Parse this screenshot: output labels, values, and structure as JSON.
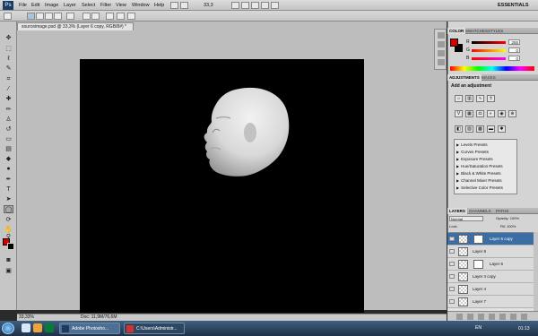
{
  "menubar": {
    "logo": "Ps",
    "items": [
      "File",
      "Edit",
      "Image",
      "Layer",
      "Select",
      "Filter",
      "View",
      "Window",
      "Help"
    ],
    "zoom": "33,3",
    "workspace": "ESSENTIALS"
  },
  "document": {
    "tab_title": "sourceimage.psd @ 33,3% (Layer 6 copy, RGB/8#) *",
    "zoom": "33,33%",
    "doc_info": "Doc: 11,9M/76,6M"
  },
  "color_panel": {
    "tabs": [
      "COLOR",
      "SWATCHES",
      "STYLES"
    ],
    "channels": [
      {
        "label": "R",
        "value": "255"
      },
      {
        "label": "G",
        "value": "0"
      },
      {
        "label": "B",
        "value": "0"
      }
    ],
    "fg_color": "#d40000",
    "bg_color": "#000000"
  },
  "adjustments": {
    "tabs": [
      "ADJUSTMENTS",
      "MASKS"
    ],
    "title": "Add an adjustment",
    "presets": [
      "Levels Presets",
      "Curves Presets",
      "Exposure Presets",
      "Hue/Saturation Presets",
      "Black & White Presets",
      "Channel Mixer Presets",
      "Selective Color Presets"
    ]
  },
  "layers_panel": {
    "tabs": [
      "LAYERS",
      "CHANNELS",
      "PATHS"
    ],
    "blend_mode": "Normal",
    "opacity_label": "Opacity:",
    "opacity_value": "100%",
    "lock_label": "Lock:",
    "fill_label": "Fill:",
    "fill_value": "100%",
    "layers": [
      {
        "name": "Layer 6 copy",
        "selected": true,
        "mask": true
      },
      {
        "name": "Layer 8",
        "selected": false,
        "mask": false
      },
      {
        "name": "Layer 6",
        "selected": false,
        "mask": true
      },
      {
        "name": "Layer 4 copy",
        "selected": false,
        "mask": false
      },
      {
        "name": "Layer 4",
        "selected": false,
        "mask": false
      },
      {
        "name": "Layer 7",
        "selected": false,
        "mask": false
      }
    ]
  },
  "taskbar": {
    "buttons": [
      "Adobe Photosho...",
      "C:\\Users\\Administr..."
    ],
    "clock": "01:13",
    "language": "EN"
  }
}
